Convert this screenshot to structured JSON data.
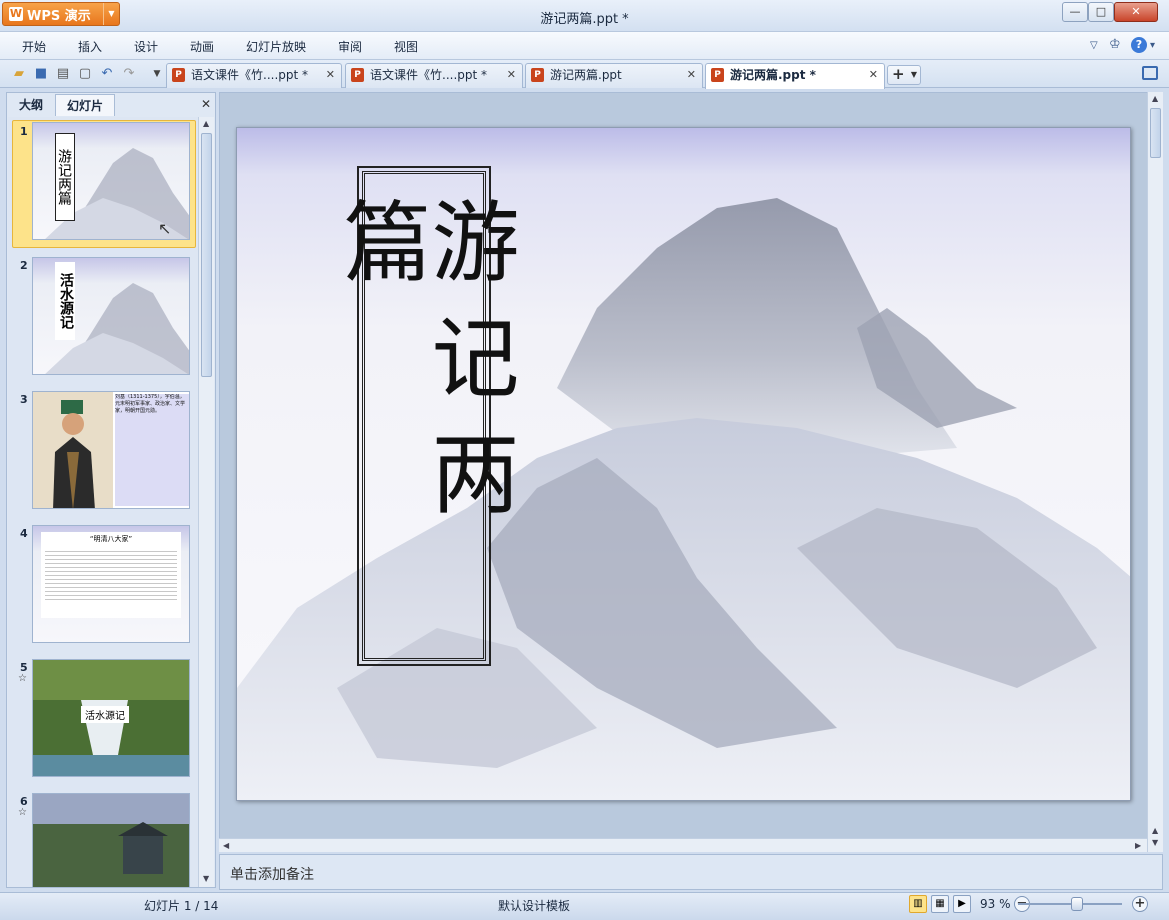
{
  "app": {
    "button_label": "WPS 演示",
    "logo_glyph": "W"
  },
  "window": {
    "title": "游记两篇.ppt *"
  },
  "menu": [
    "开始",
    "插入",
    "设计",
    "动画",
    "幻灯片放映",
    "审阅",
    "视图"
  ],
  "tabs": [
    {
      "label": "语文课件《竹....ppt *",
      "active": false
    },
    {
      "label": "语文课件《竹....ppt *",
      "active": false
    },
    {
      "label": "游记两篇.ppt",
      "active": false
    },
    {
      "label": "游记两篇.ppt *",
      "active": true
    }
  ],
  "left_panel": {
    "tabs": [
      "大纲",
      "幻灯片"
    ],
    "active_tab": "幻灯片",
    "slides": [
      {
        "number": "1",
        "title": "游记两篇",
        "selected": true
      },
      {
        "number": "2",
        "title": "活水源记"
      },
      {
        "number": "3",
        "caption": "刘基（1311-1375），字伯温，元末明初军事家、政治家、文学家，明朝开国元勋。"
      },
      {
        "number": "4",
        "heading": "“明清八大家”"
      },
      {
        "number": "5",
        "label": "活水源记",
        "has_animation": true
      },
      {
        "number": "6",
        "has_animation": true
      }
    ]
  },
  "slide": {
    "title": "游记两篇"
  },
  "notes": {
    "placeholder": "单击添加备注"
  },
  "status": {
    "slide_counter": "幻灯片 1 / 14",
    "template": "默认设计模板",
    "zoom": "93 %",
    "zoom_level": 0.5
  },
  "colors": {
    "accent_orange": "#e8761c",
    "selection": "#fde38a",
    "chrome_blue": "#cfdcee"
  }
}
